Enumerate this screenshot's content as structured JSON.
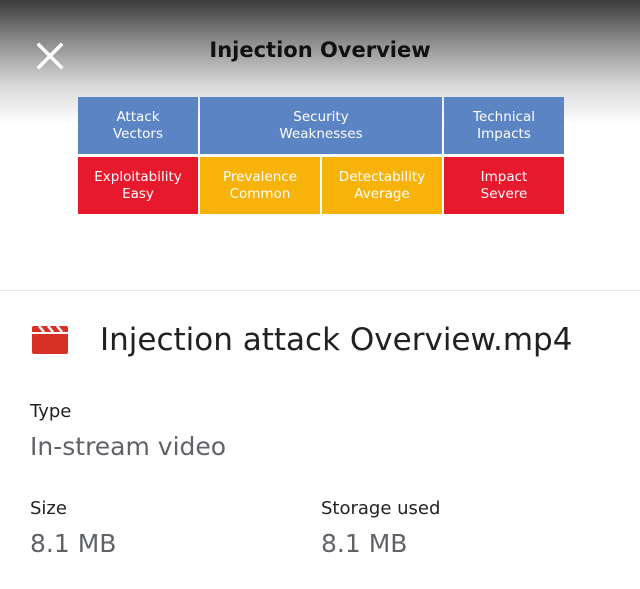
{
  "preview": {
    "title": "Injection Overview",
    "close_icon": "close-icon",
    "table": {
      "header": [
        {
          "line1": "Attack",
          "line2": "Vectors",
          "color": "#5b84c4"
        },
        {
          "line1": "Security",
          "line2": "Weaknesses",
          "color": "#5b84c4"
        },
        {
          "line1": "Technical",
          "line2": "Impacts",
          "color": "#5b84c4"
        }
      ],
      "ratings": [
        {
          "line1": "Exploitability",
          "line2": "Easy",
          "color": "#e8192c"
        },
        {
          "line1": "Prevalence",
          "line2": "Common",
          "color": "#f7b30a"
        },
        {
          "line1": "Detectability",
          "line2": "Average",
          "color": "#f7b30a"
        },
        {
          "line1": "Impact",
          "line2": "Severe",
          "color": "#e8192c"
        }
      ]
    }
  },
  "file": {
    "icon": "video-file-icon",
    "icon_color": "#d93025",
    "name": "Injection attack Overview.mp4"
  },
  "details": {
    "type_label": "Type",
    "type_value": "In-stream video",
    "size_label": "Size",
    "size_value": "8.1 MB",
    "storage_label": "Storage used",
    "storage_value": "8.1 MB"
  }
}
